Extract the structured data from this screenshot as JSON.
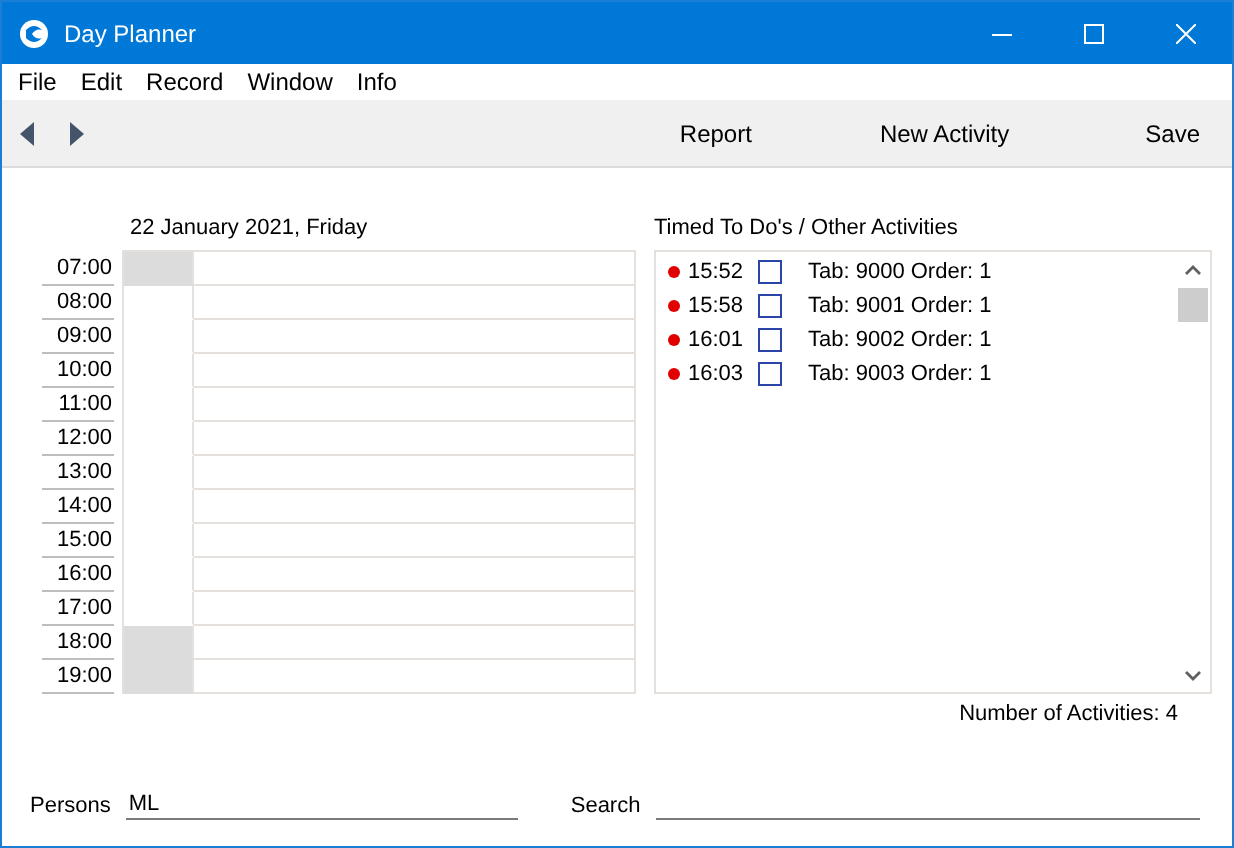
{
  "window": {
    "title": "Day Planner"
  },
  "menu": [
    "File",
    "Edit",
    "Record",
    "Window",
    "Info"
  ],
  "toolbar": {
    "buttons": [
      "Report",
      "New Activity",
      "Save"
    ]
  },
  "day": {
    "date": "22 January 2021, Friday",
    "hours": [
      {
        "time": "07:00",
        "shaded": true
      },
      {
        "time": "08:00",
        "shaded": false
      },
      {
        "time": "09:00",
        "shaded": false
      },
      {
        "time": "10:00",
        "shaded": false
      },
      {
        "time": "11:00",
        "shaded": false
      },
      {
        "time": "12:00",
        "shaded": false
      },
      {
        "time": "13:00",
        "shaded": false
      },
      {
        "time": "14:00",
        "shaded": false
      },
      {
        "time": "15:00",
        "shaded": false
      },
      {
        "time": "16:00",
        "shaded": false
      },
      {
        "time": "17:00",
        "shaded": false
      },
      {
        "time": "18:00",
        "shaded": true
      },
      {
        "time": "19:00",
        "shaded": true
      }
    ]
  },
  "activities": {
    "title": "Timed To Do's / Other Activities",
    "items": [
      {
        "color": "#e00000",
        "time": "15:52",
        "checked": false,
        "text": "Tab: 9000 Order: 1"
      },
      {
        "color": "#e00000",
        "time": "15:58",
        "checked": false,
        "text": "Tab: 9001 Order: 1"
      },
      {
        "color": "#e00000",
        "time": "16:01",
        "checked": false,
        "text": "Tab: 9002 Order: 1"
      },
      {
        "color": "#e00000",
        "time": "16:03",
        "checked": false,
        "text": "Tab: 9003 Order: 1"
      }
    ],
    "count": "Number of Activities: 4"
  },
  "persons": {
    "label": "Persons",
    "value": "ML"
  },
  "search": {
    "label": "Search"
  }
}
